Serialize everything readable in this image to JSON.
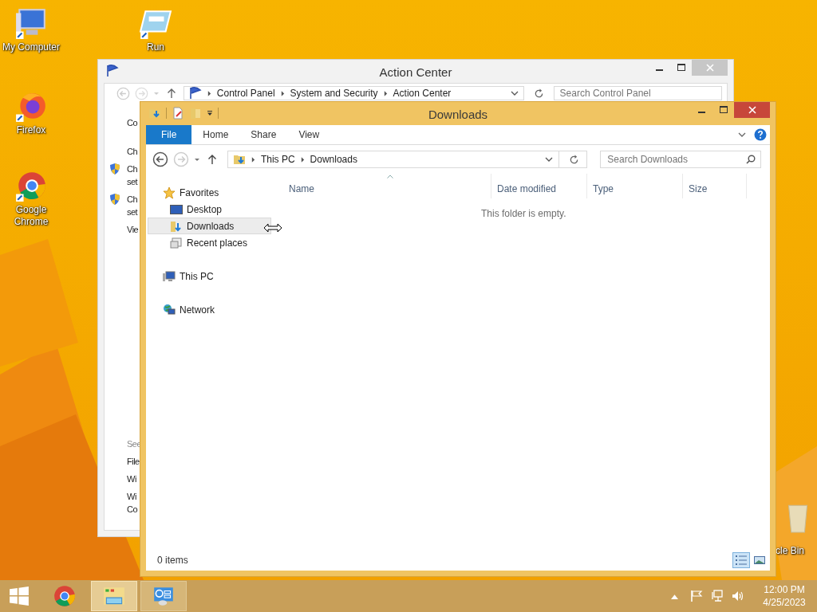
{
  "desktop_icons": [
    {
      "label": "My Computer",
      "kind": "computer"
    },
    {
      "label": "Run",
      "kind": "run"
    },
    {
      "label": "Firefox",
      "kind": "firefox"
    },
    {
      "label": "Google Chrome",
      "kind": "chrome"
    },
    {
      "label": "cle Bin",
      "kind": "recycle_bin"
    }
  ],
  "action_center": {
    "title": "Action Center",
    "breadcrumb": [
      "Control Panel",
      "System and Security",
      "Action Center"
    ],
    "search": {
      "placeholder": "Search Control Panel"
    },
    "side_links": [
      {
        "lines": [
          "Co"
        ],
        "kind": "link"
      },
      {
        "lines": [
          "Ch"
        ],
        "kind": "link"
      },
      {
        "lines": [
          "Ch",
          "set"
        ],
        "kind": "shield"
      },
      {
        "lines": [
          "Ch",
          "set"
        ],
        "kind": "shield"
      },
      {
        "lines": [
          "Vie"
        ],
        "kind": "link"
      },
      {
        "lines": [
          "See"
        ],
        "kind": "heading"
      },
      {
        "lines": [
          "File"
        ],
        "kind": "link"
      },
      {
        "lines": [
          "Wi"
        ],
        "kind": "link"
      },
      {
        "lines": [
          "Wi",
          "Co"
        ],
        "kind": "link"
      }
    ]
  },
  "explorer": {
    "title": "Downloads",
    "ribbon_tabs": [
      {
        "label": "File",
        "kind": "file",
        "selected": false
      },
      {
        "label": "Home",
        "kind": "tab",
        "selected": false
      },
      {
        "label": "Share",
        "kind": "tab",
        "selected": false
      },
      {
        "label": "View",
        "kind": "tab",
        "selected": false
      }
    ],
    "address": [
      "This PC",
      "Downloads"
    ],
    "search": {
      "placeholder": "Search Downloads"
    },
    "columns": [
      {
        "label": "Name",
        "sorted": true
      },
      {
        "label": "Date modified",
        "sorted": false
      },
      {
        "label": "Type",
        "sorted": false
      },
      {
        "label": "Size",
        "sorted": false
      }
    ],
    "empty_message": "This folder is empty.",
    "nav": [
      {
        "label": "Favorites",
        "kind": "favorites",
        "selected": false,
        "children": [
          {
            "label": "Desktop",
            "kind": "desktop",
            "selected": false
          },
          {
            "label": "Downloads",
            "kind": "downloads",
            "selected": true
          },
          {
            "label": "Recent places",
            "kind": "recent",
            "selected": false
          }
        ]
      },
      {
        "label": "This PC",
        "kind": "pc",
        "selected": false
      },
      {
        "label": "Network",
        "kind": "network",
        "selected": false
      }
    ],
    "status": "0 items",
    "view_buttons": [
      {
        "kind": "details",
        "selected": true
      },
      {
        "kind": "large_icons",
        "selected": false
      }
    ]
  },
  "taskbar": {
    "buttons": [
      {
        "kind": "start",
        "selected": false
      },
      {
        "kind": "chrome",
        "selected": false
      },
      {
        "kind": "explorer",
        "selected": true
      },
      {
        "kind": "control_panel",
        "selected": false
      }
    ],
    "time": "12:00 PM",
    "date": "4/25/2023"
  }
}
